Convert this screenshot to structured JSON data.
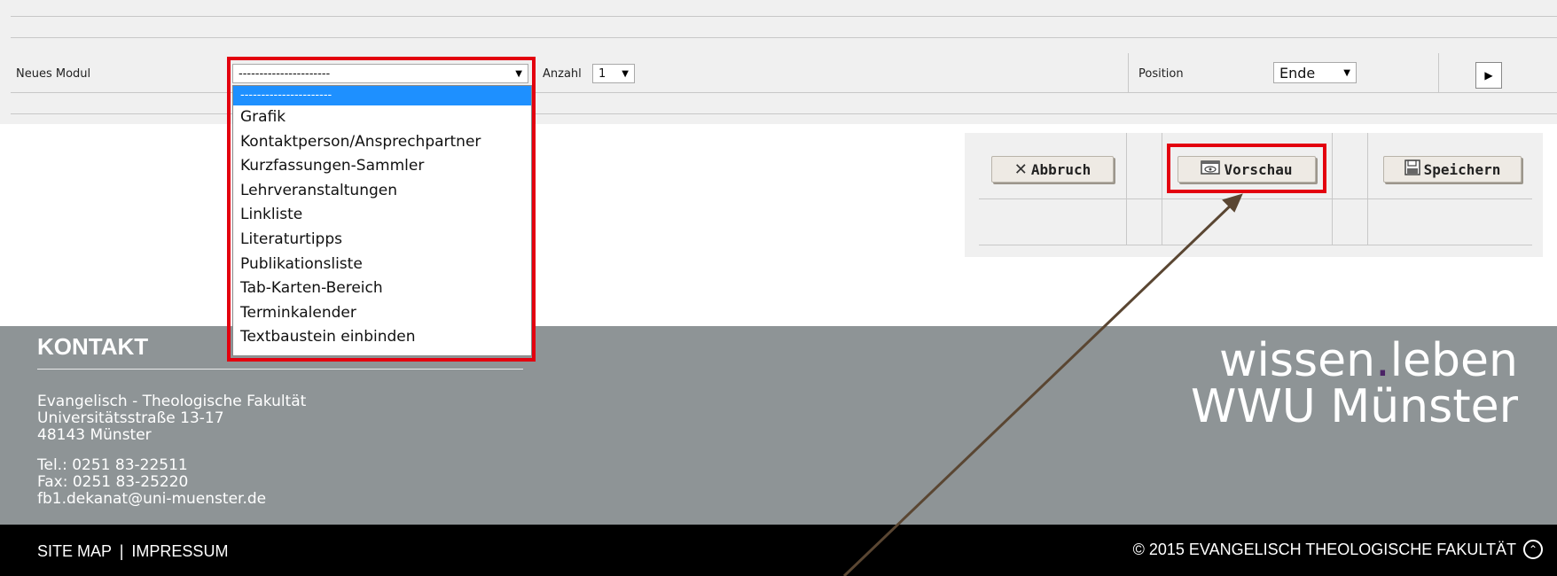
{
  "module_panel": {
    "neues_modul_label": "Neues Modul",
    "module_select_value": "----------------------",
    "anzahl_label": "Anzahl",
    "anzahl_value": "1",
    "position_label": "Position",
    "position_value": "Ende",
    "go_icon": "play-icon"
  },
  "dropdown": {
    "options": [
      "----------------------",
      "Grafik",
      "Kontaktperson/Ansprechpartner",
      "Kurzfassungen-Sammler",
      "Lehrveranstaltungen",
      "Linkliste",
      "Literaturtipps",
      "Publikationsliste",
      "Tab-Karten-Bereich",
      "Terminkalender",
      "Textbaustein einbinden"
    ],
    "selected_index": 0
  },
  "buttons": {
    "abbruch": "Abbruch",
    "vorschau": "Vorschau",
    "speichern": "Speichern"
  },
  "footer": {
    "kontakt_title": "KONTAKT",
    "address_line1": "Evangelisch - Theologische Fakultät",
    "address_line2": "Universitätsstraße 13-17",
    "address_line3": "48143 Münster",
    "tel": "Tel.: 0251 83-22511",
    "fax": "Fax: 0251 83-25220",
    "email": "fb1.dekanat@uni-muenster.de",
    "brand_word1": "wissen",
    "brand_dot": ".",
    "brand_word2": "leben",
    "brand_line2": "WWU Münster"
  },
  "bottom_bar": {
    "site_map": "SITE MAP",
    "separator": "|",
    "impressum": "IMPRESSUM",
    "copyright": "© 2015 EVANGELISCH THEOLOGISCHE FAKULTÄT"
  },
  "colors": {
    "highlight_red": "#e3000f",
    "dropdown_selected": "#1e90ff",
    "footer_gray": "#8e9496",
    "arrow_brown": "#5a4632",
    "brand_dot": "#4b2366"
  }
}
